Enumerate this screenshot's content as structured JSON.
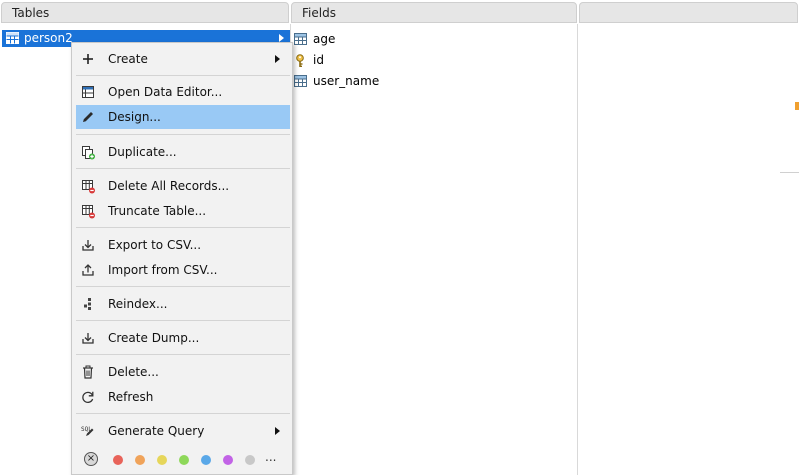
{
  "panels": {
    "tables_header": "Tables",
    "fields_header": "Fields"
  },
  "tables": {
    "selected_table": "person2"
  },
  "fields": [
    {
      "name": "age",
      "icon": "table-column-icon"
    },
    {
      "name": "id",
      "icon": "key-icon"
    },
    {
      "name": "user_name",
      "icon": "table-column-icon"
    }
  ],
  "context_menu": {
    "items": [
      {
        "id": "create",
        "label": "Create",
        "icon": "plus-icon",
        "submenu": true
      },
      {
        "id": "open-data-editor",
        "label": "Open Data Editor...",
        "icon": "grid-window-icon"
      },
      {
        "id": "design",
        "label": "Design...",
        "icon": "pencil-icon",
        "highlighted": true
      },
      {
        "id": "duplicate",
        "label": "Duplicate...",
        "icon": "duplicate-icon"
      },
      {
        "id": "delete-all-records",
        "label": "Delete All Records...",
        "icon": "table-delete-icon"
      },
      {
        "id": "truncate-table",
        "label": "Truncate Table...",
        "icon": "table-delete-icon"
      },
      {
        "id": "export-csv",
        "label": "Export to CSV...",
        "icon": "export-icon"
      },
      {
        "id": "import-csv",
        "label": "Import from CSV...",
        "icon": "import-icon"
      },
      {
        "id": "reindex",
        "label": "Reindex...",
        "icon": "reindex-icon"
      },
      {
        "id": "create-dump",
        "label": "Create Dump...",
        "icon": "dump-icon"
      },
      {
        "id": "delete",
        "label": "Delete...",
        "icon": "trash-icon"
      },
      {
        "id": "refresh",
        "label": "Refresh",
        "icon": "refresh-icon"
      },
      {
        "id": "generate-query",
        "label": "Generate Query",
        "icon": "sql-icon",
        "submenu": true
      }
    ],
    "colors": [
      "#e8635a",
      "#f0a35a",
      "#e6d65a",
      "#8ed85a",
      "#5aa8e8",
      "#c263e6",
      "#c8c8c8"
    ],
    "more_label": "..."
  },
  "theme": {
    "selection": "#1a73d8",
    "menu_highlight": "#99c9f5"
  }
}
